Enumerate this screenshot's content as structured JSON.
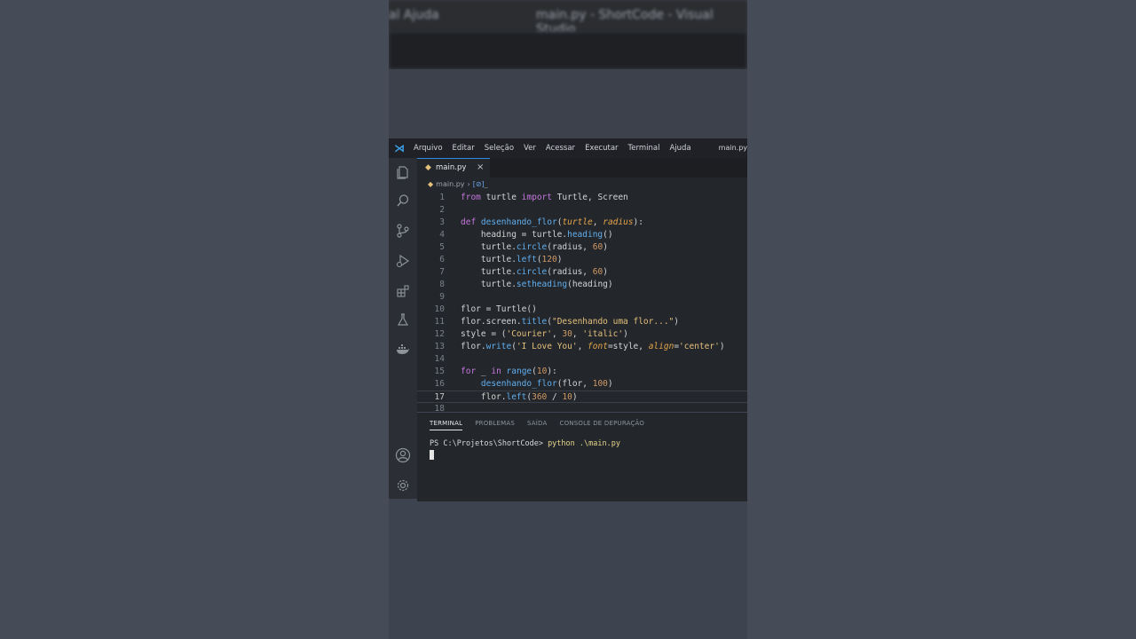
{
  "blurred_header": {
    "left_text": "al   Ajuda",
    "title_text": "main.py - ShortCode - Visual Studio"
  },
  "menubar": {
    "items": [
      "Arquivo",
      "Editar",
      "Seleção",
      "Ver",
      "Acessar",
      "Executar",
      "Terminal",
      "Ajuda"
    ],
    "window_title": "main.py"
  },
  "activity_bar": {
    "icons": [
      "explorer-icon",
      "search-icon",
      "source-control-icon",
      "run-debug-icon",
      "extensions-icon",
      "testing-icon",
      "docker-icon",
      "account-icon",
      "settings-gear-icon"
    ]
  },
  "tab": {
    "label": "main.py",
    "close": "×"
  },
  "breadcrumb": {
    "file": "main.py",
    "separator": "›",
    "symbol": "_"
  },
  "code": {
    "active_line": 17,
    "lines": [
      {
        "n": "1",
        "text": "from turtle import Turtle, Screen"
      },
      {
        "n": "2",
        "text": ""
      },
      {
        "n": "3",
        "text": "def desenhando_flor(turtle, radius):"
      },
      {
        "n": "4",
        "text": "    heading = turtle.heading()"
      },
      {
        "n": "5",
        "text": "    turtle.circle(radius, 60)"
      },
      {
        "n": "6",
        "text": "    turtle.left(120)"
      },
      {
        "n": "7",
        "text": "    turtle.circle(radius, 60)"
      },
      {
        "n": "8",
        "text": "    turtle.setheading(heading)"
      },
      {
        "n": "9",
        "text": ""
      },
      {
        "n": "10",
        "text": "flor = Turtle()"
      },
      {
        "n": "11",
        "text": "flor.screen.title(\"Desenhando uma flor...\")"
      },
      {
        "n": "12",
        "text": "style = ('Courier', 30, 'italic')"
      },
      {
        "n": "13",
        "text": "flor.write('I Love You', font=style, align='center')"
      },
      {
        "n": "14",
        "text": ""
      },
      {
        "n": "15",
        "text": "for _ in range(10):"
      },
      {
        "n": "16",
        "text": "    desenhando_flor(flor, 100)"
      },
      {
        "n": "17",
        "text": "    flor.left(360 / 10)"
      },
      {
        "n": "18",
        "text": ""
      }
    ]
  },
  "panel": {
    "tabs": [
      "TERMINAL",
      "PROBLEMAS",
      "SAÍDA",
      "CONSOLE DE DEPURAÇÃO"
    ],
    "active_tab": "TERMINAL",
    "prompt": "PS C:\\Projetos\\ShortCode> ",
    "command": "python .\\main.py"
  },
  "colors": {
    "keyword": "#c678dd",
    "function": "#61afef",
    "parameter": "#e5a64a",
    "number": "#d19a66",
    "string": "#e5c07b",
    "accent": "#2d8ce2"
  }
}
